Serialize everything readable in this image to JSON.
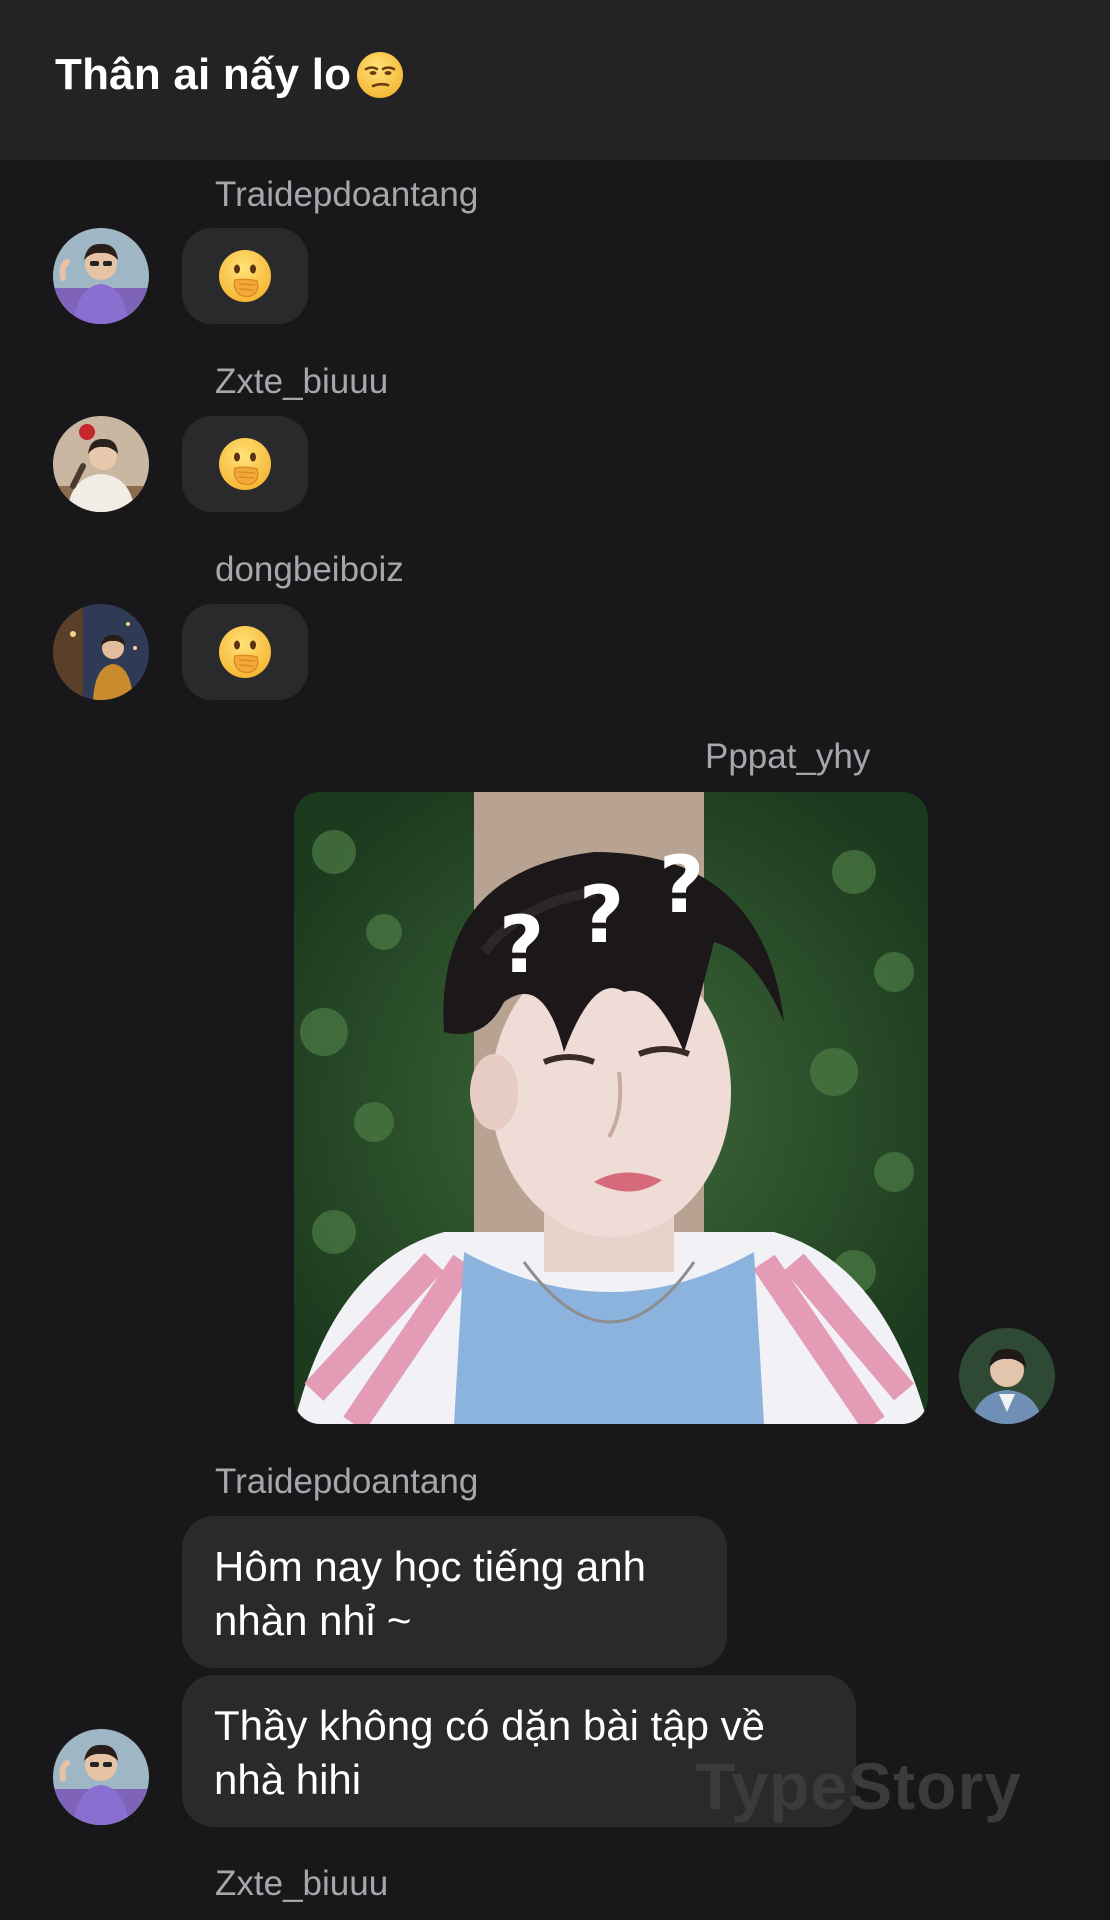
{
  "header": {
    "title": "Thân ai nấy lo",
    "title_emoji": "unamused-face-emoji"
  },
  "messages": [
    {
      "sender": "Traidepdoantang",
      "type": "emoji",
      "emoji": "hand-over-mouth-emoji"
    },
    {
      "sender": "Zxte_biuuu",
      "type": "emoji",
      "emoji": "hand-over-mouth-emoji"
    },
    {
      "sender": "dongbeiboiz",
      "type": "emoji",
      "emoji": "hand-over-mouth-emoji"
    },
    {
      "sender": "Pppat_yhy",
      "type": "image",
      "image": "photo-of-confused-boy-with-question-marks",
      "overlay_text": [
        "?",
        "?",
        "?"
      ]
    },
    {
      "sender": "Traidepdoantang",
      "type": "text",
      "texts": [
        "Hôm nay học tiếng anh nhàn nhỉ ~",
        "Thầy không có dặn bài tập về nhà hihi"
      ]
    },
    {
      "sender": "Zxte_biuuu",
      "type": "pending"
    }
  ],
  "watermark": "TypeStory",
  "colors": {
    "background": "#18181a",
    "header": "#232325",
    "bubble": "#2a2a2c",
    "sender_text": "#a7a7ab",
    "emoji_yellow": "#f7c23a"
  }
}
